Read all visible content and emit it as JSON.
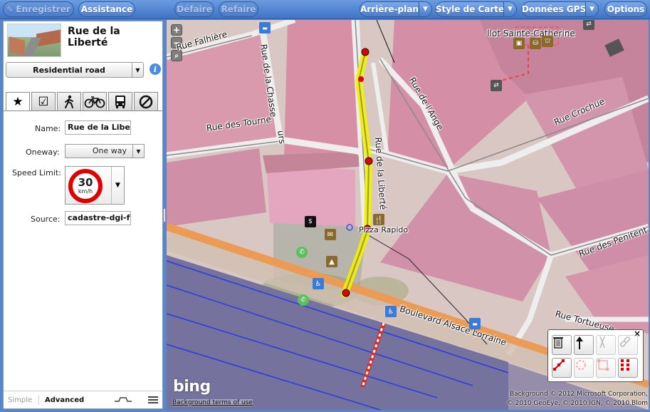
{
  "toolbar": {
    "save_label": "Enregistrer",
    "help_label": "Assistance",
    "undo_label": "Défaire",
    "redo_label": "Refaire",
    "background_label": "Arrière-plan",
    "map_style_label": "Style de Carte",
    "gps_label": "Données GPS",
    "options_label": "Options"
  },
  "sidebar": {
    "feature_title": "Rue de la Liberté",
    "preset": "Residential road",
    "tabs": [
      "star-icon",
      "checkbox-icon",
      "pedestrian-icon",
      "bicycle-icon",
      "bus-icon",
      "no-entry-icon"
    ],
    "fields": {
      "name_label": "Name:",
      "name_value": "Rue de la Libert",
      "oneway_label": "Oneway:",
      "oneway_value": "One way",
      "speed_label": "Speed Limit:",
      "speed_value": "30",
      "speed_unit": "km/h",
      "source_label": "Source:",
      "source_value": "cadastre-dgi-fr"
    },
    "footer": {
      "simple_label": "Simple",
      "advanced_label": "Advanced"
    }
  },
  "map": {
    "zoom_in": "+",
    "zoom_out": "−",
    "bing_logo": "bing",
    "terms": "Background terms of use",
    "attribution_line1": "Background © 2012 Microsoft Corporation,",
    "attribution_line2": "© 2010 GeoEye, © 2010 IGN, © 2010 Blom",
    "labels": {
      "rue_falhiere": "Rue Falhière",
      "rue_chassaing": "Rue de la Chasse",
      "rue_chassaing2": "urs",
      "rue_tourne": "Rue des Tourne",
      "rue_ange": "Rue de l'Ange",
      "rue_crochue": "Rue Crochue",
      "rue_liberte": "Rue de la Liberté",
      "ilot": "Ilot Sainte-Catherine",
      "pizza": "Pizza Rapido",
      "rue_penitents": "Rue des Penitent",
      "rue_tortue": "Rue Tortueuse",
      "bd_alsace": "Boulevard Alsace Lorraine"
    },
    "highlight_color": "#f2f200",
    "node_color": "#e00000"
  },
  "toolbox": {
    "tools": [
      "delete-icon",
      "reverse-direction-icon",
      "split-icon",
      "disconnect-icon",
      "straighten-icon",
      "circularise-icon",
      "orthogonalise-icon",
      "quadrilateralise-icon"
    ]
  }
}
